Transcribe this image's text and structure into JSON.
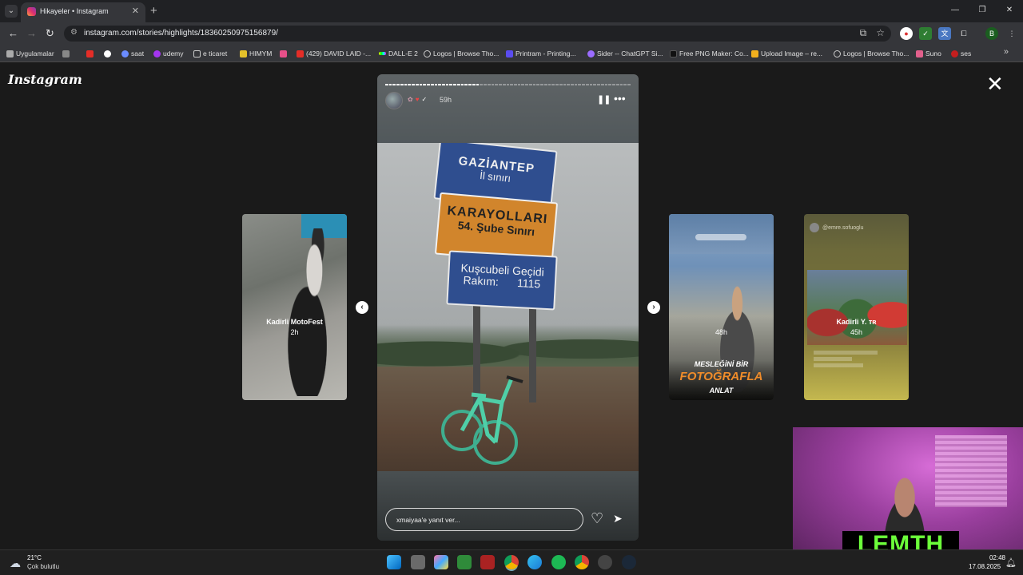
{
  "browser": {
    "tab_title": "Hikayeler • Instagram",
    "url": "instagram.com/stories/highlights/18360250975156879/",
    "bookmarks": [
      {
        "label": "Uygulamalar"
      },
      {
        "label": "saat"
      },
      {
        "label": "udemy"
      },
      {
        "label": "e ticaret"
      },
      {
        "label": "HIMYM"
      },
      {
        "label": "(429) DAVID LAID -..."
      },
      {
        "label": "DALL-E 2"
      },
      {
        "label": "Logos | Browse Tho..."
      },
      {
        "label": "Printram - Printing..."
      },
      {
        "label": "Sider -- ChatGPT Si..."
      },
      {
        "label": "Free PNG Maker: Co..."
      },
      {
        "label": "Upload Image – re..."
      },
      {
        "label": "Logos | Browse Tho..."
      },
      {
        "label": "Suno"
      },
      {
        "label": "ses"
      }
    ],
    "profile_initial": "B"
  },
  "instagram": {
    "logo": "Instagram",
    "story": {
      "time": "59h",
      "reply_placeholder": "xmaiyaa'e yanıt ver...",
      "signs": {
        "city": "GAZİANTEP",
        "city_sub": "İl sınırı",
        "org": "KARAYOLLARI",
        "org_sub": "54. Şube Sınırı",
        "pass": "Kuşcubeli Geçidi",
        "altitude_label": "Rakım:",
        "altitude_value": "1115"
      }
    },
    "side_stories": [
      {
        "name": "Kadirli MotoFest",
        "time": "2h"
      },
      {
        "name": "",
        "time": "48h",
        "caption_1": "MESLEĞİNİ BİR",
        "caption_2": "FOTOĞRAFLA",
        "caption_3": "ANLAT"
      },
      {
        "name": "Kadirli Y. ᴛʀ",
        "time": "45h",
        "header": "@emre.sofuoglu"
      }
    ]
  },
  "stream_overlay": {
    "badge": "LEMTH"
  },
  "taskbar": {
    "temperature": "21°C",
    "weather": "Çok bulutlu",
    "time": "02:48",
    "date": "17.08.2025"
  }
}
